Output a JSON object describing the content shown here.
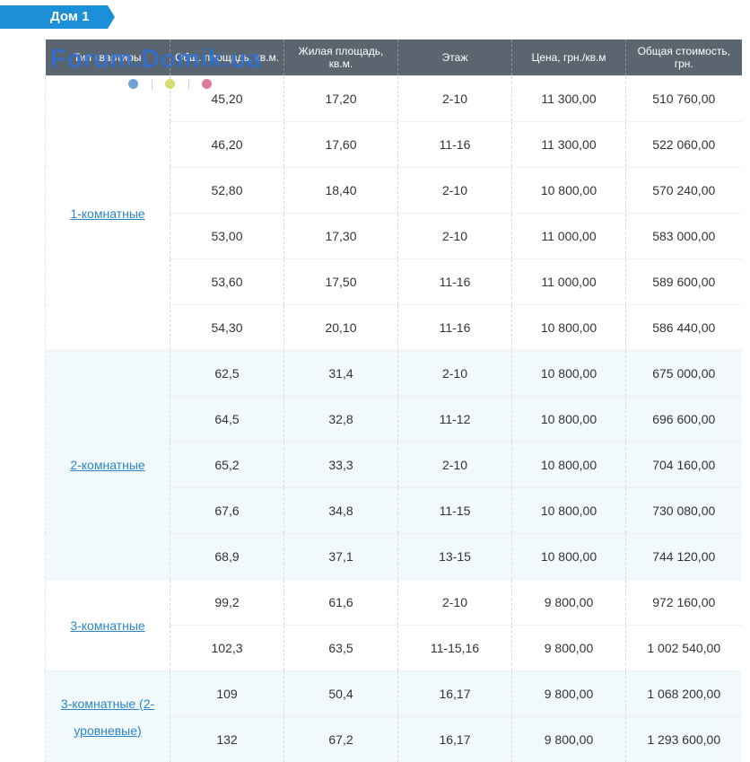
{
  "house_label": "Дом 1",
  "watermark": "Forum.Domik.ua",
  "colors": {
    "tab": "#1b8fd8",
    "header_bg": "#5a6570",
    "link": "#2a86c8",
    "shade": "#f2f9fc",
    "dot_blue": "#6ea3d4",
    "dot_yellow": "#d6dc6e",
    "dot_pink": "#e07b97"
  },
  "columns": [
    "Тип квартиры",
    "Общ. площадь, кв.м.",
    "Жилая площадь, кв.м.",
    "Этаж",
    "Цена, грн./кв.м",
    "Общая стоимость, грн."
  ],
  "groups": [
    {
      "type": "1-комнатные",
      "rows": [
        [
          "45,20",
          "17,20",
          "2-10",
          "11 300,00",
          "510 760,00"
        ],
        [
          "46,20",
          "17,60",
          "11-16",
          "11 300,00",
          "522 060,00"
        ],
        [
          "52,80",
          "18,40",
          "2-10",
          "10 800,00",
          "570 240,00"
        ],
        [
          "53,00",
          "17,30",
          "2-10",
          "11 000,00",
          "583 000,00"
        ],
        [
          "53,60",
          "17,50",
          "11-16",
          "11 000,00",
          "589 600,00"
        ],
        [
          "54,30",
          "20,10",
          "11-16",
          "10 800,00",
          "586 440,00"
        ]
      ]
    },
    {
      "type": "2-комнатные",
      "rows": [
        [
          "62,5",
          "31,4",
          "2-10",
          "10 800,00",
          "675 000,00"
        ],
        [
          "64,5",
          "32,8",
          "11-12",
          "10 800,00",
          "696 600,00"
        ],
        [
          "65,2",
          "33,3",
          "2-10",
          "10 800,00",
          "704 160,00"
        ],
        [
          "67,6",
          "34,8",
          "11-15",
          "10 800,00",
          "730 080,00"
        ],
        [
          "68,9",
          "37,1",
          "13-15",
          "10 800,00",
          "744 120,00"
        ]
      ]
    },
    {
      "type": "3-комнатные",
      "rows": [
        [
          "99,2",
          "61,6",
          "2-10",
          "9 800,00",
          "972 160,00"
        ],
        [
          "102,3",
          "63,5",
          "11-15,16",
          "9 800,00",
          "1 002 540,00"
        ]
      ]
    },
    {
      "type": "3-комнатные (2-уровневые)",
      "rows": [
        [
          "109",
          "50,4",
          "16,17",
          "9 800,00",
          "1 068 200,00"
        ],
        [
          "132",
          "67,2",
          "16,17",
          "9 800,00",
          "1 293 600,00"
        ]
      ]
    }
  ]
}
